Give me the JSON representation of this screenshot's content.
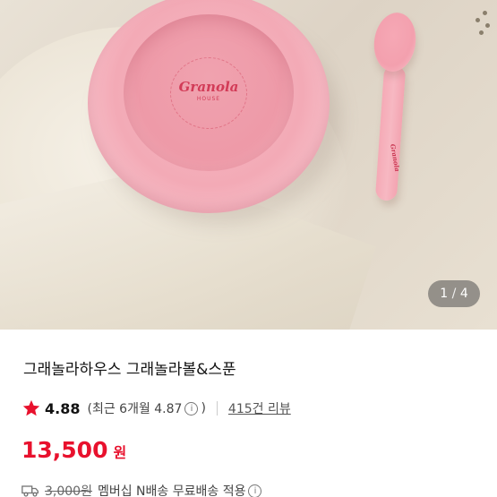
{
  "image": {
    "counter_current": "1",
    "counter_sep": "/",
    "counter_total": "4",
    "bowl_logo_name": "Granola",
    "bowl_logo_sub": "HOUSE",
    "spoon_logo": "Granola"
  },
  "product": {
    "title": "그래놀라하우스 그래놀라볼&스푼",
    "rating": "4.88",
    "recent_rating": "(최근 6개월 4.87",
    "recent_rating_close": ")",
    "reviews": "415건 리뷰",
    "price": "13,500",
    "currency": "원",
    "shipping_old": "3,000원",
    "shipping_text": "멤버십 N배송 무료배송 적용"
  },
  "icons": {
    "star": "star-icon",
    "info": "info-icon",
    "truck": "truck-icon"
  },
  "colors": {
    "accent": "#e8112d",
    "star": "#e8112d"
  }
}
